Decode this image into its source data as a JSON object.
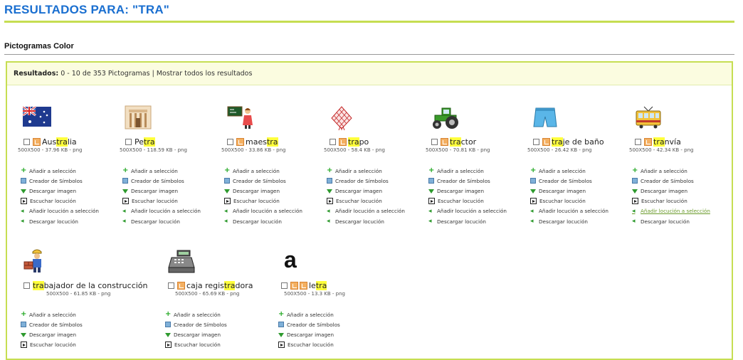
{
  "header": {
    "title": "RESULTADOS PARA: \"TRA\""
  },
  "section": {
    "title": "Pictogramas Color"
  },
  "results": {
    "label": "Resultados:",
    "range": "0 - 10 de 353 Pictogramas",
    "separator": "|",
    "show_all": "Mostrar todos los resultados"
  },
  "actions": {
    "add": "Añadir a selección",
    "creator": "Creador de Símbolos",
    "download_image": "Descargar imagen",
    "listen": "Escuchar locución",
    "add_audio": "Añadir locución a selección",
    "download_audio": "Descargar locución"
  },
  "items": [
    {
      "pre": "Aus",
      "hl": "tra",
      "post": "lia",
      "meta": "500X500 - 37.96 KB - png",
      "icon": "australia-flag-icon"
    },
    {
      "pre": "Pe",
      "hl": "tra",
      "post": "",
      "meta": "500X500 - 118.59 KB - png",
      "icon": "petra-ruins-icon"
    },
    {
      "pre": "maes",
      "hl": "tra",
      "post": "",
      "meta": "500X500 - 33.86 KB - png",
      "icon": "teacher-icon"
    },
    {
      "pre": "",
      "hl": "tra",
      "post": "po",
      "meta": "500X500 - 58.4 KB - png",
      "icon": "cloth-rag-icon"
    },
    {
      "pre": "",
      "hl": "tra",
      "post": "ctor",
      "meta": "500X500 - 70.81 KB - png",
      "icon": "tractor-icon"
    },
    {
      "pre": "",
      "hl": "tra",
      "post": "je de baño",
      "meta": "500X500 - 26.42 KB - png",
      "icon": "swim-shorts-icon"
    },
    {
      "pre": "",
      "hl": "tra",
      "post": "nvía",
      "meta": "500X500 - 42.34 KB - png",
      "icon": "tram-icon"
    },
    {
      "pre": "",
      "hl": "tra",
      "post": "bajador de la construcción",
      "meta": "500X500 - 61.85 KB - png",
      "icon": "construction-worker-icon"
    },
    {
      "pre": "caja regis",
      "hl": "tra",
      "post": "dora",
      "meta": "500X500 - 65.69 KB - png",
      "icon": "cash-register-icon"
    },
    {
      "pre": "le",
      "hl": "tra",
      "post": "",
      "meta": "500X500 - 13.3 KB - png",
      "icon": "letter-a-icon",
      "glyph": "a"
    }
  ]
}
